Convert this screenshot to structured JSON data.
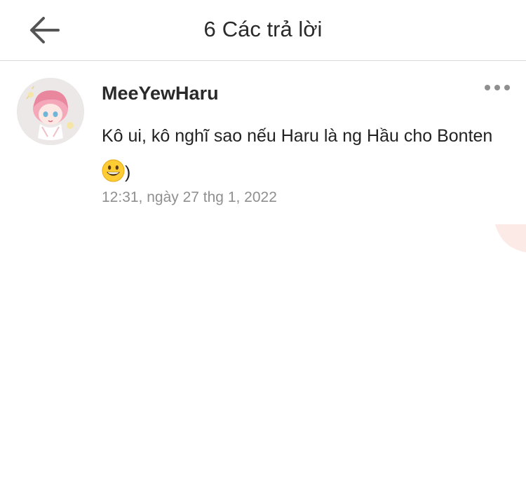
{
  "header": {
    "reply_count": "6",
    "title": "Các trả lời",
    "back_icon": "arrow-left-icon"
  },
  "comment": {
    "username": "MeeYewHaru",
    "text_before_emoji": "Kô ui, kô nghĩ sao nếu Haru là ng Hầu cho Bonten ",
    "emoji": "grinning-face-emoji",
    "text_after_emoji": ")",
    "timestamp": "12:31, ngày 27 thg 1, 2022",
    "more_icon": "more-horizontal-icon"
  },
  "colors": {
    "divider": "#d9d9d9",
    "timestamp": "#8f8f8f",
    "icon": "#555555",
    "emoji_face": "#ffcc33"
  }
}
